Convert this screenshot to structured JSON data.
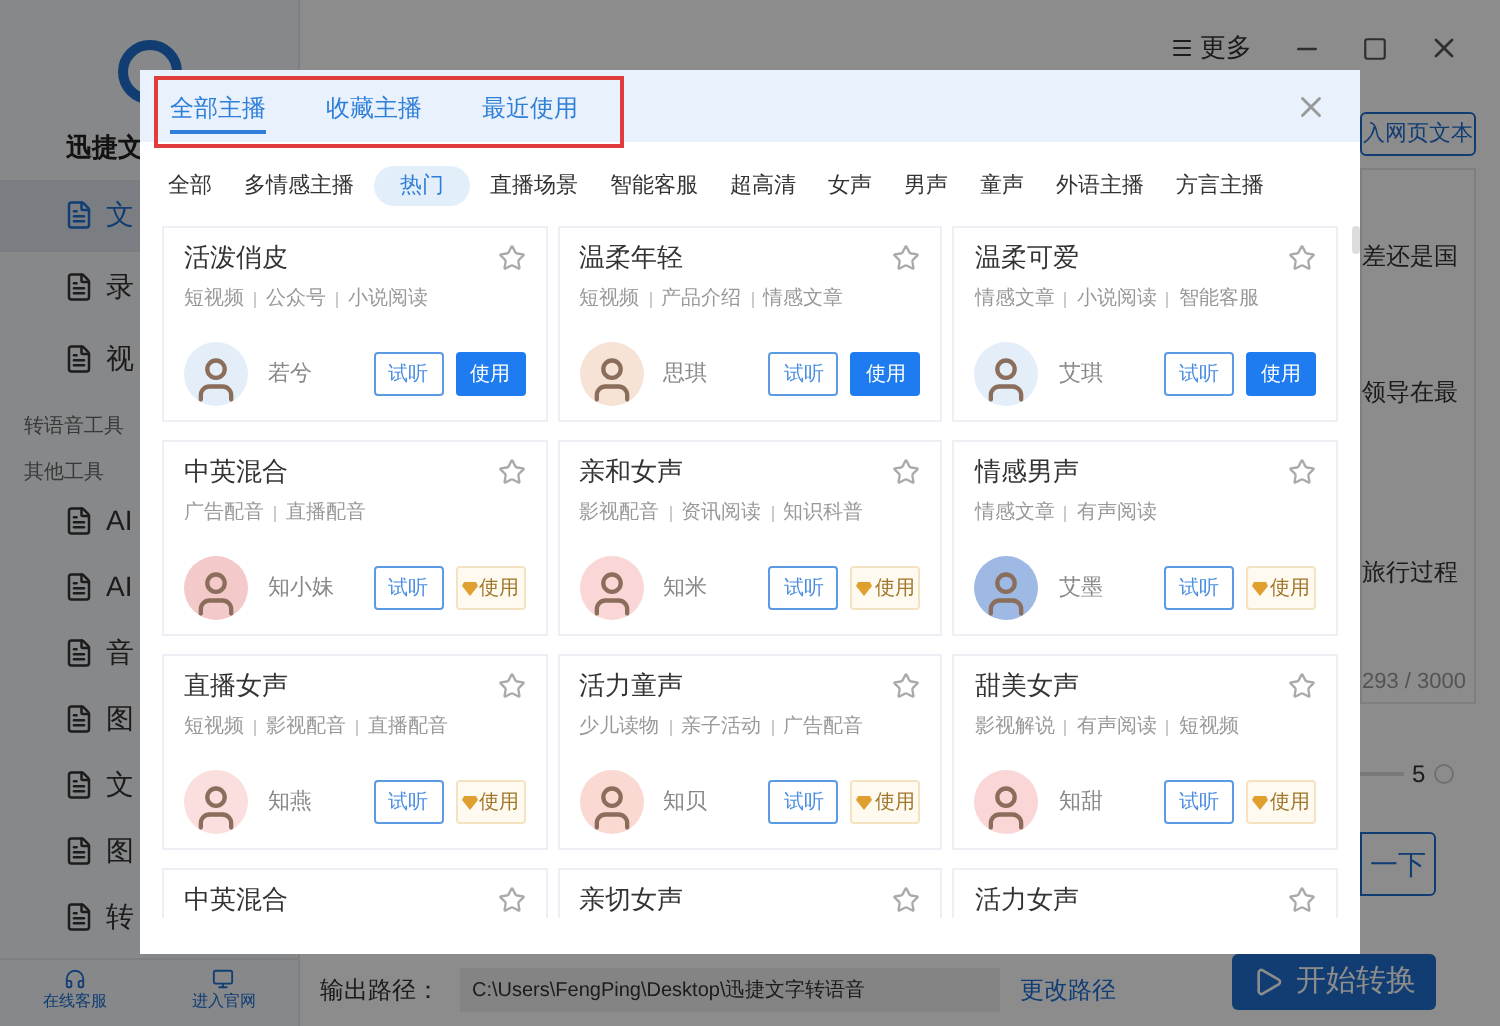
{
  "app": {
    "title": "迅捷文",
    "top_controls": {
      "more": "更多"
    },
    "sidebar": {
      "items": [
        {
          "label": "文",
          "selected": true
        },
        {
          "label": "录",
          "selected": false
        },
        {
          "label": "视",
          "selected": false
        }
      ],
      "sections": [
        {
          "title": "转语音工具"
        },
        {
          "title": "其他工具"
        }
      ],
      "tools": [
        {
          "label": "AI"
        },
        {
          "label": "AI"
        },
        {
          "label": "音"
        },
        {
          "label": "图"
        },
        {
          "label": "文"
        },
        {
          "label": "图"
        },
        {
          "label": "转"
        }
      ],
      "footer": [
        {
          "label": "在线客服"
        },
        {
          "label": "进入官网"
        }
      ]
    },
    "right_panel": {
      "import_button": "入网页文本",
      "lines": [
        "差还是国",
        "领导在最",
        "旅行过程"
      ],
      "count": "293 / 3000",
      "slider_value": "5",
      "preview_button": "一下"
    },
    "output": {
      "label": "输出路径：",
      "path": "C:\\Users\\FengPing\\Desktop\\迅捷文字转语音",
      "change_link": "更改路径"
    },
    "convert_button": "开始转换"
  },
  "dialog": {
    "tabs": [
      {
        "label": "全部主播",
        "selected": true
      },
      {
        "label": "收藏主播",
        "selected": false
      },
      {
        "label": "最近使用",
        "selected": false
      }
    ],
    "categories": [
      {
        "label": "全部",
        "selected": false
      },
      {
        "label": "多情感主播",
        "selected": false
      },
      {
        "label": "热门",
        "selected": true
      },
      {
        "label": "直播场景",
        "selected": false
      },
      {
        "label": "智能客服",
        "selected": false
      },
      {
        "label": "超高清",
        "selected": false
      },
      {
        "label": "女声",
        "selected": false
      },
      {
        "label": "男声",
        "selected": false
      },
      {
        "label": "童声",
        "selected": false
      },
      {
        "label": "外语主播",
        "selected": false
      },
      {
        "label": "方言主播",
        "selected": false
      }
    ],
    "voices": [
      {
        "title": "活泼俏皮",
        "favorited": false,
        "tags": [
          "短视频",
          "公众号",
          "小说阅读"
        ],
        "name": "若兮",
        "listen": "试听",
        "use": "使用",
        "kind": "free"
      },
      {
        "title": "温柔年轻",
        "favorited": false,
        "tags": [
          "短视频",
          "产品介绍",
          "情感文章"
        ],
        "name": "思琪",
        "listen": "试听",
        "use": "使用",
        "kind": "free"
      },
      {
        "title": "温柔可爱",
        "favorited": false,
        "tags": [
          "情感文章",
          "小说阅读",
          "智能客服"
        ],
        "name": "艾琪",
        "listen": "试听",
        "use": "使用",
        "kind": "free"
      },
      {
        "title": "中英混合",
        "favorited": false,
        "tags": [
          "广告配音",
          "直播配音"
        ],
        "name": "知小妹",
        "listen": "试听",
        "use": "使用",
        "kind": "vip"
      },
      {
        "title": "亲和女声",
        "favorited": false,
        "tags": [
          "影视配音",
          "资讯阅读",
          "知识科普"
        ],
        "name": "知米",
        "listen": "试听",
        "use": "使用",
        "kind": "vip"
      },
      {
        "title": "情感男声",
        "favorited": false,
        "tags": [
          "情感文章",
          "有声阅读"
        ],
        "name": "艾墨",
        "listen": "试听",
        "use": "使用",
        "kind": "vip"
      },
      {
        "title": "直播女声",
        "favorited": false,
        "tags": [
          "短视频",
          "影视配音",
          "直播配音"
        ],
        "name": "知燕",
        "listen": "试听",
        "use": "使用",
        "kind": "vip"
      },
      {
        "title": "活力童声",
        "favorited": false,
        "tags": [
          "少儿读物",
          "亲子活动",
          "广告配音"
        ],
        "name": "知贝",
        "listen": "试听",
        "use": "使用",
        "kind": "vip"
      },
      {
        "title": "甜美女声",
        "favorited": false,
        "tags": [
          "影视解说",
          "有声阅读",
          "短视频"
        ],
        "name": "知甜",
        "listen": "试听",
        "use": "使用",
        "kind": "vip"
      },
      {
        "title": "中英混合",
        "favorited": false,
        "kind": "partial"
      },
      {
        "title": "亲切女声",
        "favorited": false,
        "kind": "partial"
      },
      {
        "title": "活力女声",
        "favorited": false,
        "kind": "partial"
      }
    ]
  }
}
